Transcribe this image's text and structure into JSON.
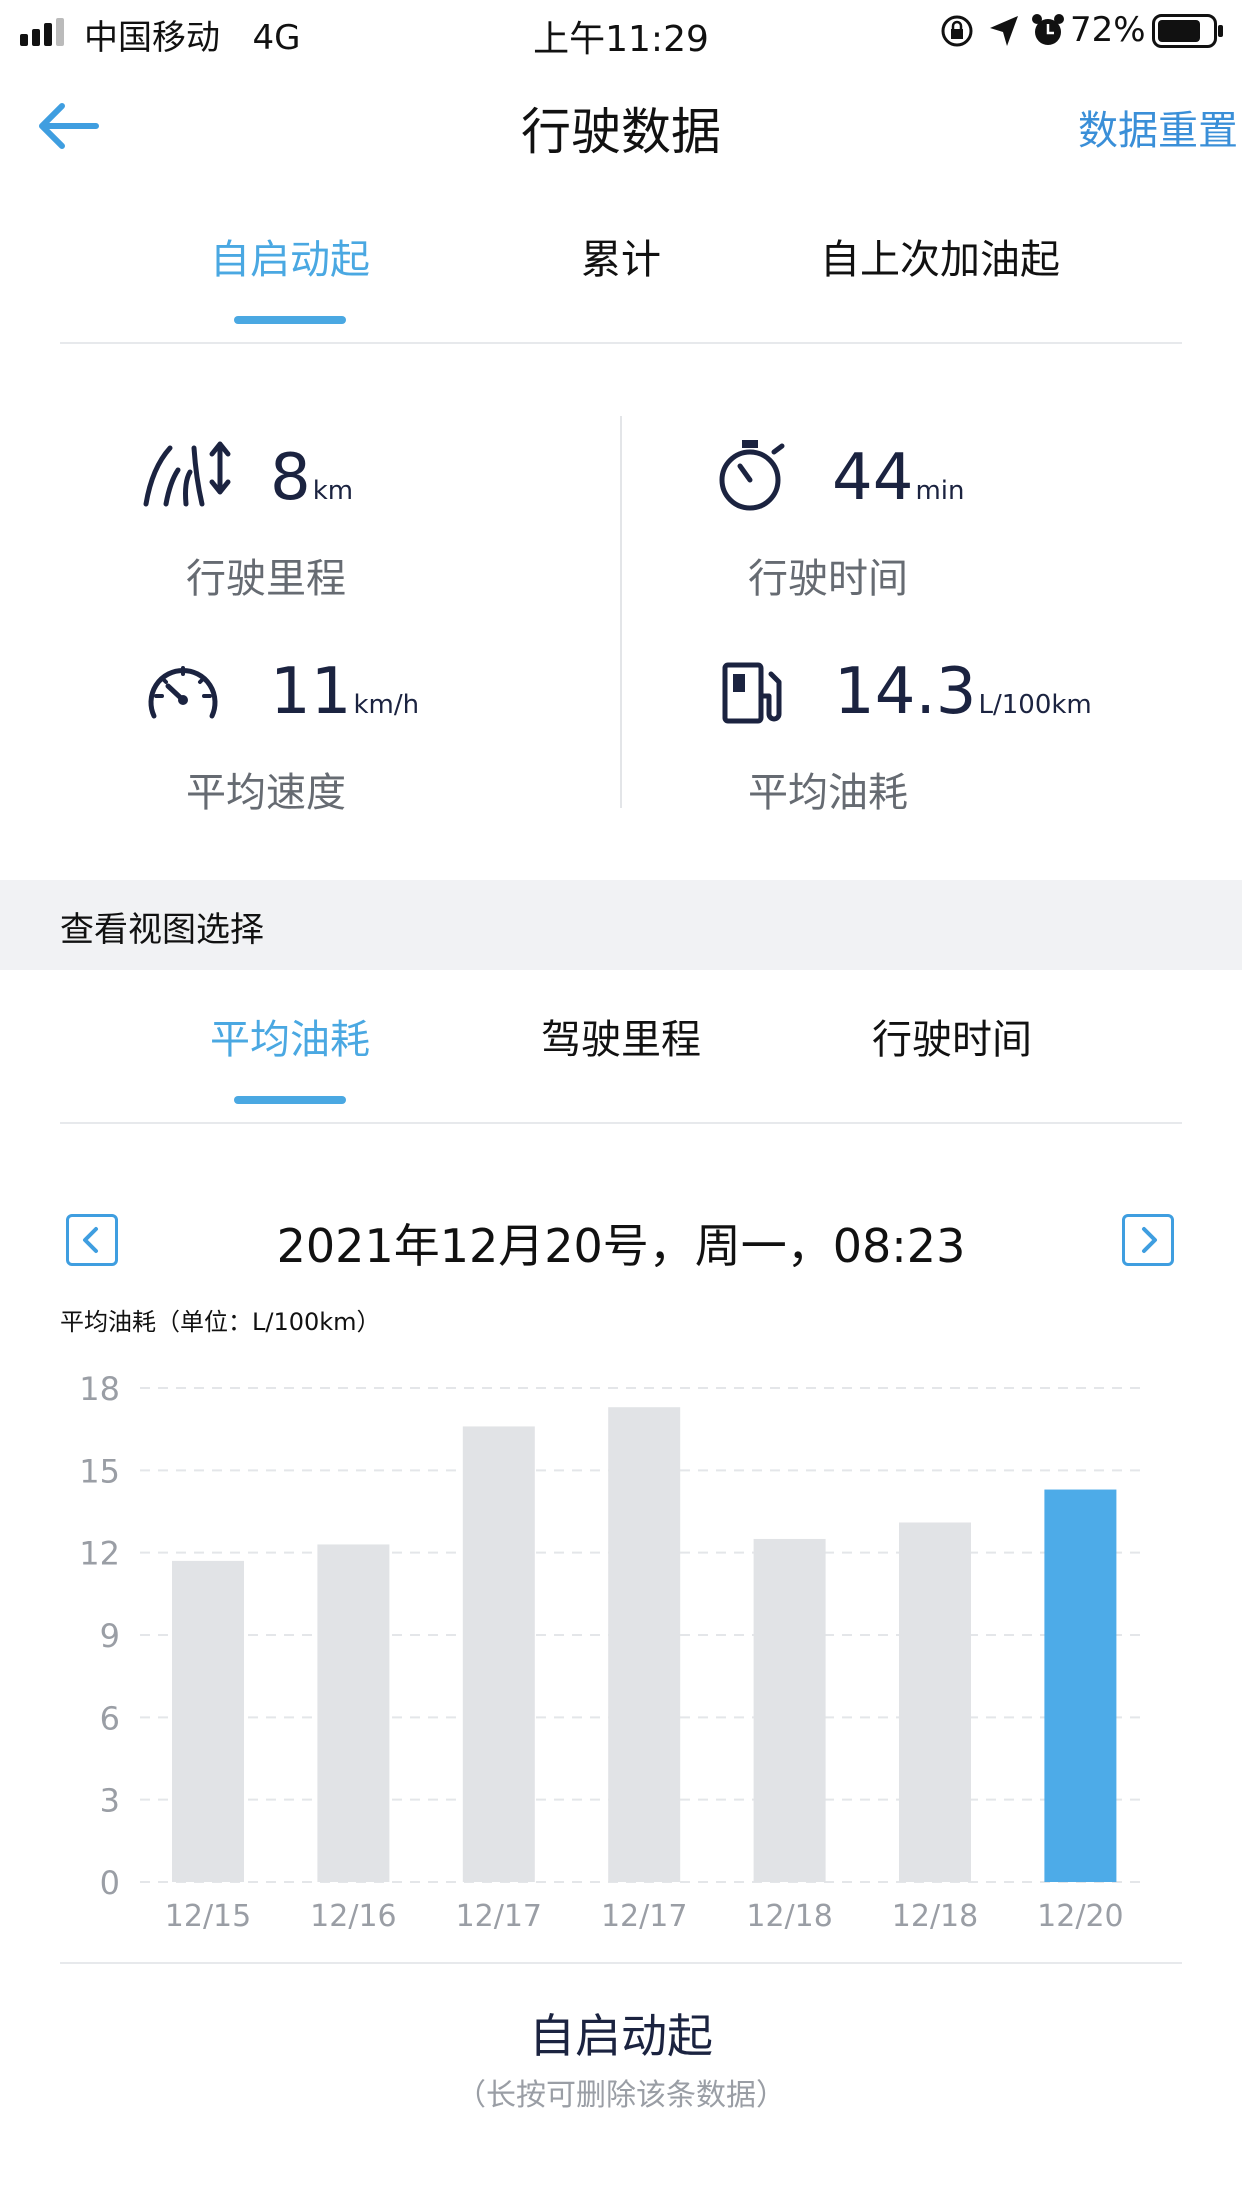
{
  "status_bar": {
    "carrier": "中国移动",
    "network": "4G",
    "time": "上午11:29",
    "battery": "72%"
  },
  "nav": {
    "title": "行驶数据",
    "reset_label": "数据重置"
  },
  "period_tabs": [
    {
      "label": "自启动起",
      "active": true
    },
    {
      "label": "累计",
      "active": false
    },
    {
      "label": "自上次加油起",
      "active": false
    }
  ],
  "stats": {
    "distance": {
      "value": "8",
      "unit": "km",
      "label": "行驶里程"
    },
    "duration": {
      "value": "44",
      "unit": "min",
      "label": "行驶时间"
    },
    "speed": {
      "value": "11",
      "unit": "km/h",
      "label": "平均速度"
    },
    "fuel": {
      "value": "14.3",
      "unit": "L/100km",
      "label": "平均油耗"
    }
  },
  "view_section_label": "查看视图选择",
  "view_tabs": [
    {
      "label": "平均油耗",
      "active": true
    },
    {
      "label": "驾驶里程",
      "active": false
    },
    {
      "label": "行驶时间",
      "active": false
    }
  ],
  "date_label": "2021年12月20号，周一，08:23",
  "chart_data": {
    "type": "bar",
    "title": "平均油耗（单位：L/100km）",
    "categories": [
      "12/15",
      "12/16",
      "12/17",
      "12/17",
      "12/18",
      "12/18",
      "12/20"
    ],
    "values": [
      11.7,
      12.3,
      16.6,
      17.3,
      12.5,
      13.1,
      14.3
    ],
    "highlight_index": 6,
    "ylim": [
      0,
      18
    ],
    "yticks": [
      0,
      3,
      6,
      9,
      12,
      15,
      18
    ],
    "grid": true,
    "colors": {
      "bar": "#e1e3e6",
      "highlight": "#4dabe8",
      "grid": "#e4e6e9",
      "tick": "#9a9ea5"
    }
  },
  "footer": {
    "title": "自启动起",
    "hint": "（长按可删除该条数据）"
  }
}
